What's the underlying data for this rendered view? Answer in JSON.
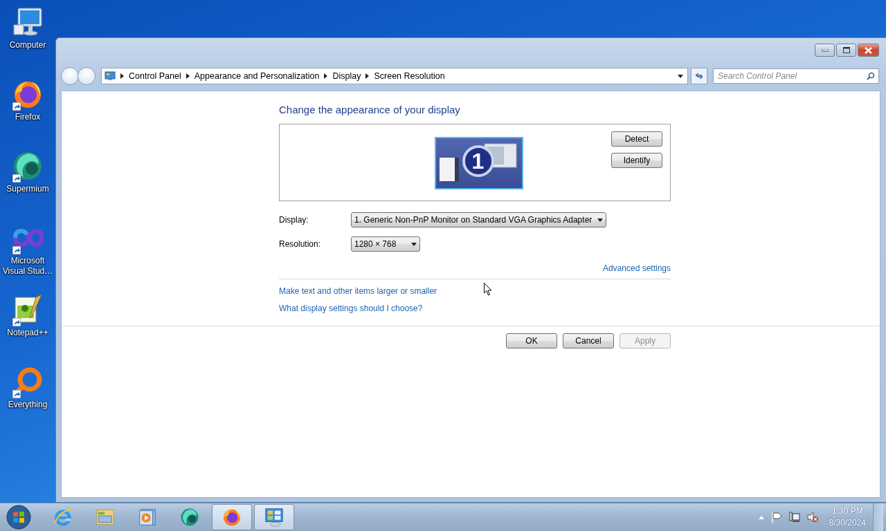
{
  "desktop_icons": [
    {
      "label": "Computer",
      "kind": "computer",
      "shortcut": false
    },
    {
      "label": "Firefox",
      "kind": "firefox",
      "shortcut": true
    },
    {
      "label": "Supermium",
      "kind": "supermium",
      "shortcut": true
    },
    {
      "label": "Microsoft Visual Stud…",
      "kind": "visualstudio",
      "shortcut": true
    },
    {
      "label": "Notepad++",
      "kind": "notepad",
      "shortcut": true
    },
    {
      "label": "Everything",
      "kind": "everything",
      "shortcut": true
    }
  ],
  "window": {
    "breadcrumb": [
      "Control Panel",
      "Appearance and Personalization",
      "Display",
      "Screen Resolution"
    ],
    "search": {
      "placeholder": "Search Control Panel"
    },
    "heading": "Change the appearance of your display",
    "monitor": {
      "number": "1",
      "selected": true
    },
    "side_buttons": [
      "Detect",
      "Identify"
    ],
    "fields": [
      {
        "label": "Display:",
        "value": "1. Generic Non-PnP Monitor on Standard VGA Graphics Adapter"
      },
      {
        "label": "Resolution:",
        "value": "1280 × 768"
      }
    ],
    "advanced_link": "Advanced settings",
    "links": [
      "Make text and other items larger or smaller",
      "What display settings should I choose?"
    ],
    "dialog_buttons": [
      {
        "label": "OK",
        "disabled": false
      },
      {
        "label": "Cancel",
        "disabled": false
      },
      {
        "label": "Apply",
        "disabled": true
      }
    ]
  },
  "taskbar": {
    "apps": [
      {
        "kind": "ie",
        "running": false
      },
      {
        "kind": "explorer",
        "running": false
      },
      {
        "kind": "media",
        "running": false
      },
      {
        "kind": "supermium",
        "running": false
      },
      {
        "kind": "firefox",
        "running": true
      },
      {
        "kind": "controlpanel",
        "running": true
      }
    ],
    "time": "1:30 PM",
    "date": "8/30/2024"
  }
}
